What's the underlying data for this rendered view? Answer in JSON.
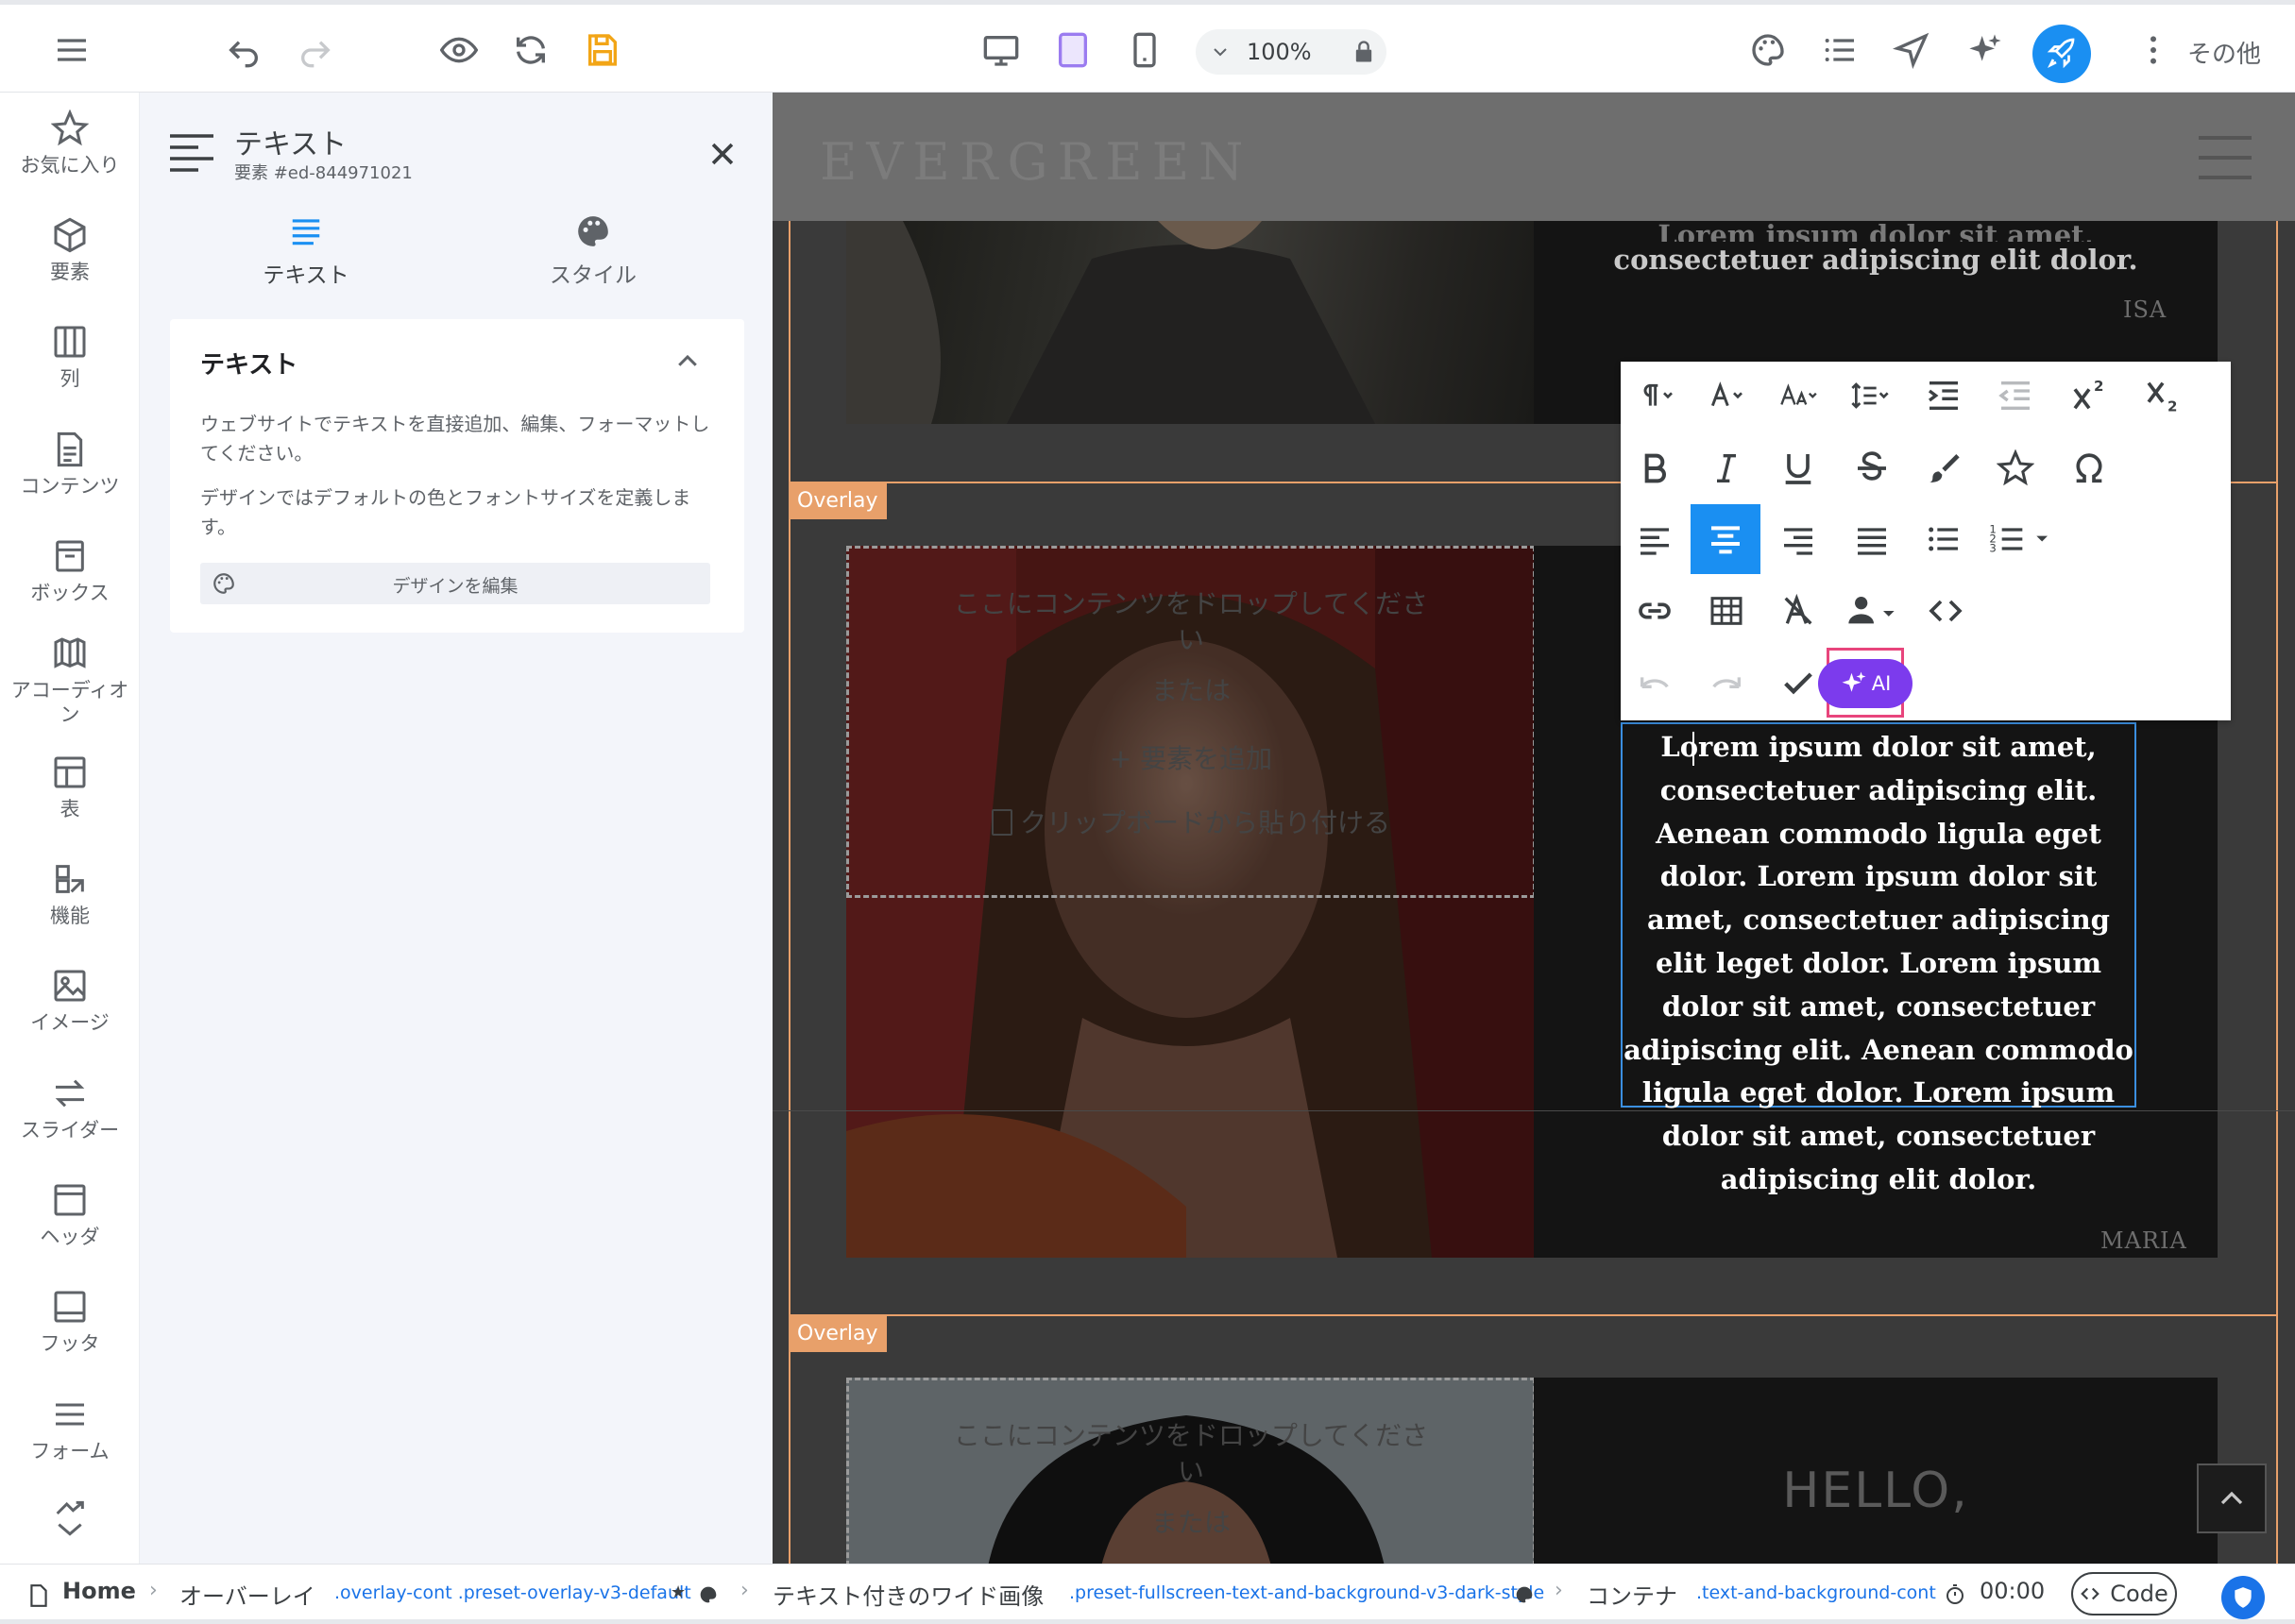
{
  "topbar": {
    "zoom": "100%",
    "more_label": "その他"
  },
  "rail": {
    "items": [
      {
        "label": "お気に入り",
        "icon": "star-icon"
      },
      {
        "label": "要素",
        "icon": "cube-icon"
      },
      {
        "label": "列",
        "icon": "columns-icon"
      },
      {
        "label": "コンテンツ",
        "icon": "document-icon"
      },
      {
        "label": "ボックス",
        "icon": "box-icon"
      },
      {
        "label": "アコーディオン",
        "icon": "accordion-icon"
      },
      {
        "label": "表",
        "icon": "table-icon"
      },
      {
        "label": "機能",
        "icon": "features-icon"
      },
      {
        "label": "イメージ",
        "icon": "image-icon"
      },
      {
        "label": "スライダー",
        "icon": "slider-icon"
      },
      {
        "label": "ヘッダ",
        "icon": "header-icon"
      },
      {
        "label": "フッタ",
        "icon": "footer-icon"
      },
      {
        "label": "フォーム",
        "icon": "form-icon"
      }
    ]
  },
  "panel": {
    "title": "テキスト",
    "subtitle": "要素 #ed-844971021",
    "tabs": [
      {
        "label": "テキスト",
        "active": true
      },
      {
        "label": "スタイル",
        "active": false
      }
    ],
    "card": {
      "title": "テキスト",
      "desc1": "ウェブサイトでテキストを直接追加、編集、フォーマットしてください。",
      "desc2": "デザインではデフォルトの色とフォントサイズを定義します。",
      "button": "デザインを編集"
    }
  },
  "canvas": {
    "logo": "EVERGREEN",
    "overlay_label": "Overlay",
    "quote_top_tail": "consectetuer adipiscing elit dolor.",
    "quote_top_partial": "Lorem ipsum dolor sit amet,",
    "signature_top": "ISA",
    "signature_mid": "MARIA",
    "drop_line1": "ここにコンテンツをドロップしてくださ",
    "drop_line2": "い",
    "drop_or": "または",
    "drop_add": "+ 要素を追加",
    "drop_paste": "クリップボードから貼り付ける",
    "edit_text": "Lorem ipsum dolor sit amet, consectetuer adipiscing elit. Aenean commodo ligula eget dolor. Lorem ipsum dolor sit amet, consectetuer adipiscing elit leget dolor. Lorem ipsum dolor sit amet, consectetuer adipiscing elit. Aenean commodo ligula eget dolor. Lorem ipsum dolor sit amet, consectetuer adipiscing elit dolor.",
    "hello": "HELLO,"
  },
  "rte": {
    "ai_label": "AI"
  },
  "bottombar": {
    "home": "Home",
    "crumb1": "オーバーレイ",
    "crumb1_class": ".overlay-cont .preset-overlay-v3-default",
    "crumb2": "テキスト付きのワイド画像",
    "crumb2_class": ".preset-fullscreen-text-and-background-v3-dark-style",
    "crumb3": "コンテナ",
    "crumb3_class": ".text-and-background-cont",
    "timer": "00:00",
    "code_label": "Code"
  },
  "colors": {
    "accent": "#1a8ff2",
    "ai": "#7c3bed",
    "highlight": "#e8457c",
    "overlay_orange": "#e8a06a"
  }
}
